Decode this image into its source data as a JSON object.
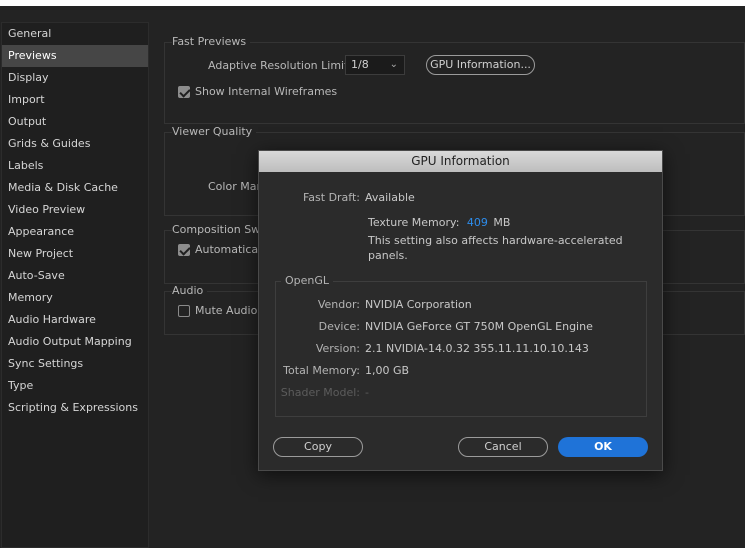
{
  "sidebar": {
    "items": [
      {
        "label": "General"
      },
      {
        "label": "Previews",
        "selected": true
      },
      {
        "label": "Display"
      },
      {
        "label": "Import"
      },
      {
        "label": "Output"
      },
      {
        "label": "Grids & Guides"
      },
      {
        "label": "Labels"
      },
      {
        "label": "Media & Disk Cache"
      },
      {
        "label": "Video Preview"
      },
      {
        "label": "Appearance"
      },
      {
        "label": "New Project"
      },
      {
        "label": "Auto-Save"
      },
      {
        "label": "Memory"
      },
      {
        "label": "Audio Hardware"
      },
      {
        "label": "Audio Output Mapping"
      },
      {
        "label": "Sync Settings"
      },
      {
        "label": "Type"
      },
      {
        "label": "Scripting & Expressions"
      }
    ]
  },
  "fast_previews": {
    "title": "Fast Previews",
    "adaptive_label": "Adaptive Resolution Limit:",
    "adaptive_value": "1/8",
    "gpu_button": "GPU Information...",
    "wireframes_label": "Show Internal Wireframes",
    "wireframes_checked": true
  },
  "viewer_quality": {
    "title": "Viewer Quality",
    "color_label": "Color Man"
  },
  "composition": {
    "title": "Composition Swit",
    "auto_label": "Automaticall",
    "auto_checked": true
  },
  "audio": {
    "title": "Audio",
    "mute_label": "Mute Audio W",
    "mute_checked": false
  },
  "gpu_dialog": {
    "title": "GPU Information",
    "fast_draft_label": "Fast Draft:",
    "fast_draft_value": "Available",
    "texture_label": "Texture Memory:",
    "texture_value": "409",
    "texture_unit": "MB",
    "note_line1": "This setting also affects hardware-accelerated",
    "note_line2": "panels.",
    "opengl_title": "OpenGL",
    "vendor_label": "Vendor:",
    "vendor_value": "NVIDIA Corporation",
    "device_label": "Device:",
    "device_value": "NVIDIA GeForce GT 750M OpenGL Engine",
    "version_label": "Version:",
    "version_value": "2.1 NVIDIA-14.0.32 355.11.11.10.10.143",
    "total_memory_label": "Total Memory:",
    "total_memory_value": "1,00 GB",
    "shader_label": "Shader Model:",
    "shader_value": "-",
    "copy_button": "Copy",
    "cancel_button": "Cancel",
    "ok_button": "OK"
  },
  "colors": {
    "accent": "#2d8ceb",
    "ok_button": "#1f73d8",
    "selected_item": "#464646"
  }
}
